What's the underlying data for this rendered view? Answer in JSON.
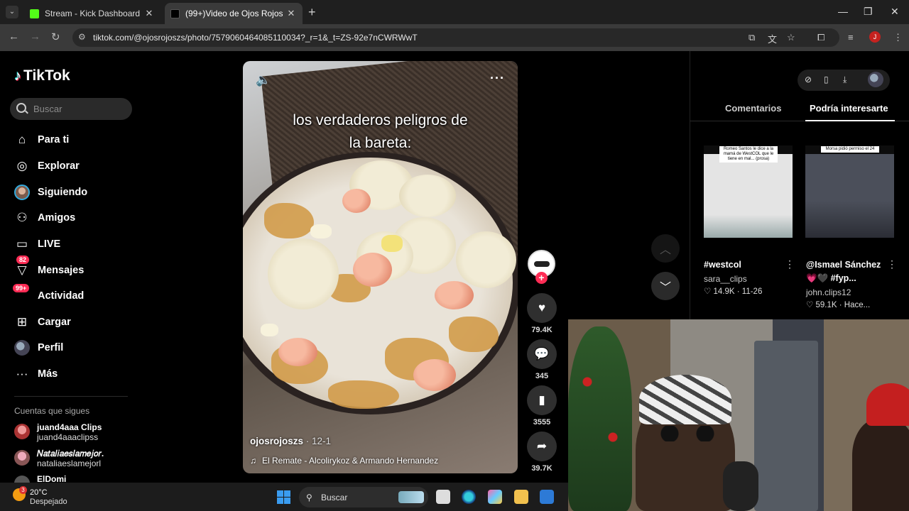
{
  "browser": {
    "tabs": [
      {
        "title": "Stream - Kick Dashboard",
        "close": "✕"
      },
      {
        "title": "(99+)Video de Ojos Rojos 🍜🔮 ...",
        "close": "✕"
      }
    ],
    "new_tab": "+",
    "url": "tiktok.com/@ojosrojoszs/photo/7579060464085110034?_r=1&_t=ZS-92e7nCWRWwT",
    "profile_initial": "J"
  },
  "tiktok": {
    "brand": "TikTok",
    "search_placeholder": "Buscar",
    "nav": [
      {
        "label": "Para ti",
        "icon": "home-icon"
      },
      {
        "label": "Explorar",
        "icon": "compass-icon"
      },
      {
        "label": "Siguiendo",
        "icon": "avatar-icon"
      },
      {
        "label": "Amigos",
        "icon": "friends-icon"
      },
      {
        "label": "LIVE",
        "icon": "live-icon"
      },
      {
        "label": "Mensajes",
        "icon": "messages-icon",
        "badge": "82"
      },
      {
        "label": "Actividad",
        "icon": "activity-icon",
        "badge": "99+"
      },
      {
        "label": "Cargar",
        "icon": "upload-icon"
      },
      {
        "label": "Perfil",
        "icon": "profile-icon"
      },
      {
        "label": "Más",
        "icon": "more-icon"
      }
    ],
    "following_title": "Cuentas que sigues",
    "following": [
      {
        "name": "juand4aaa Clips",
        "user": "juand4aaaclipss"
      },
      {
        "name": "𝑁𝑎𝑡𝑎𝑙𝑖𝑎𝑒𝑠𝑙𝑎𝑚𝑒𝑗𝑜𝑟.",
        "user": "nataliaeslamejorl"
      },
      {
        "name": "ElDomi",
        "user": ""
      }
    ]
  },
  "video": {
    "caption_line1": "los verdaderos peligros de",
    "caption_line2": "la bareta:",
    "author": "ojosrojoszs",
    "date": " · 12-1",
    "music": "El Remate - Alcolirykoz & Armando Hernandez",
    "likes": "79.4K",
    "comments": "345",
    "saves": "3555",
    "shares": "39.7K"
  },
  "panel": {
    "tab_comments": "Comentarios",
    "tab_interest": "Podría interesarte",
    "recommendations": [
      {
        "caption": "Romeo Santos le dice a la mamá de WestCOL que le tiene en mal... (prosa)",
        "title": "#westcol",
        "user": "sara__clips",
        "likes": "♡ 14.9K · 11-26"
      },
      {
        "caption": "Morsa pidió permiso el 24",
        "title": "@Ismael Sánchez",
        "title2": "💗🖤 #fyp...",
        "user": "john.clips12",
        "likes": "♡ 59.1K · Hace..."
      }
    ]
  },
  "taskbar": {
    "temp": "20°C",
    "condition": "Despejado",
    "weather_badge": "3",
    "search": "Buscar"
  }
}
